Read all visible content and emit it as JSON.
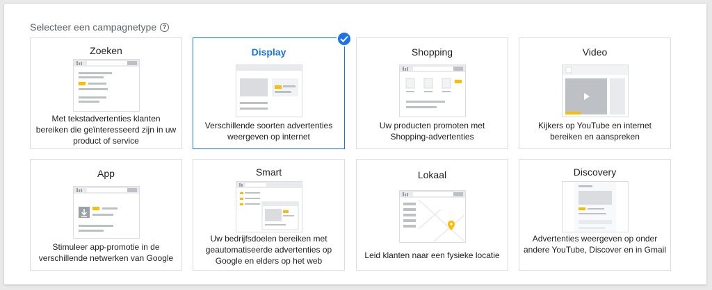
{
  "heading": "Selecteer een campagnetype",
  "colors": {
    "accent": "#1a73e8",
    "yellow": "#fbbc04",
    "illustration_gray": "#dadce0"
  },
  "cards": [
    {
      "title": "Zoeken",
      "description": "Met tekstadvertenties klanten bereiken die geïnteresseerd zijn in uw product of service",
      "selected": false
    },
    {
      "title": "Display",
      "description": "Verschillende soorten advertenties weergeven op internet",
      "selected": true
    },
    {
      "title": "Shopping",
      "description": "Uw producten promoten met Shopping-advertenties",
      "selected": false
    },
    {
      "title": "Video",
      "description": "Kijkers op YouTube en internet bereiken en aanspreken",
      "selected": false
    },
    {
      "title": "App",
      "description": "Stimuleer app-promotie in de verschillende netwerken van Google",
      "selected": false
    },
    {
      "title": "Smart",
      "description": "Uw bedrijfsdoelen bereiken met geautomatiseerde advertenties op Google en elders op het web",
      "selected": false
    },
    {
      "title": "Lokaal",
      "description": "Leid klanten naar een fysieke locatie",
      "selected": false
    },
    {
      "title": "Discovery",
      "description": "Advertenties weergeven op onder andere YouTube, Discover en in Gmail",
      "selected": false
    }
  ]
}
